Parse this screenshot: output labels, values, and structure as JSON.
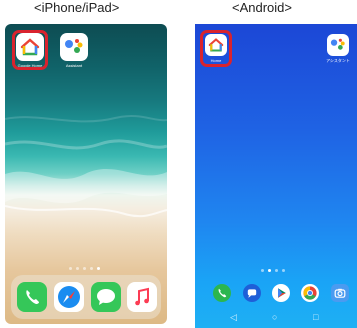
{
  "captions": {
    "ios": "<iPhone/iPad>",
    "android": "<Android>"
  },
  "ios": {
    "apps": [
      {
        "name": "Google Home",
        "label": "Google Home"
      },
      {
        "name": "Assistant",
        "label": "Assistant"
      }
    ],
    "dock": [
      "phone-icon",
      "safari-icon",
      "messages-icon",
      "music-icon"
    ]
  },
  "android": {
    "apps": [
      {
        "name": "Home",
        "label": "Home"
      },
      {
        "name": "Assistant",
        "label": "アシスタント"
      }
    ],
    "dock": [
      "phone-icon",
      "messages-icon",
      "play-store-icon",
      "chrome-icon",
      "camera-icon"
    ],
    "nav": {
      "back": "◁",
      "home": "○",
      "recents": "□"
    }
  },
  "colors": {
    "highlight": "#d9232e",
    "google_home_green": "#2aa84a",
    "android_wallpaper": "#1f63e4"
  }
}
